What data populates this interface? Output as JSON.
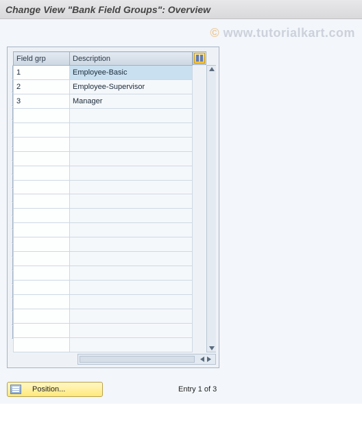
{
  "title": "Change View \"Bank Field Groups\": Overview",
  "watermark": "www.tutorialkart.com",
  "table": {
    "headers": {
      "field_grp": "Field grp",
      "description": "Description"
    },
    "rows": [
      {
        "field_grp": "1",
        "description": "Employee-Basic",
        "selected": true
      },
      {
        "field_grp": "2",
        "description": "Employee-Supervisor",
        "selected": false
      },
      {
        "field_grp": "3",
        "description": "Manager",
        "selected": false
      }
    ],
    "empty_row_count": 17
  },
  "footer": {
    "position_button": "Position...",
    "entry_text": "Entry 1 of 3"
  }
}
